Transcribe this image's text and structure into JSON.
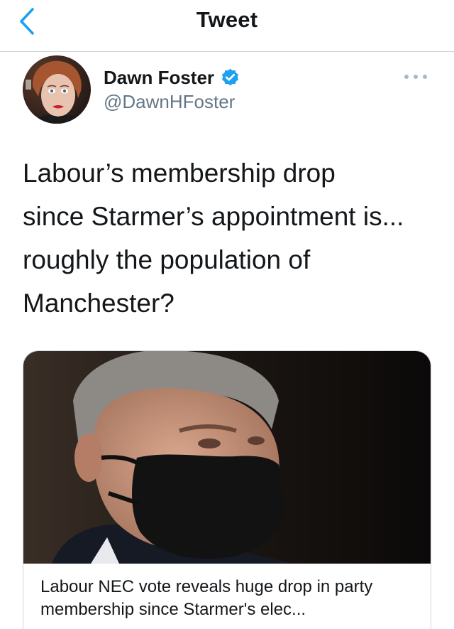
{
  "header": {
    "title": "Tweet",
    "back_icon": "chevron-left-icon"
  },
  "author": {
    "name": "Dawn Foster",
    "handle": "@DawnHFoster",
    "verified": true,
    "avatar_icon": "avatar"
  },
  "tweet": {
    "text": "Labour’s membership drop\nsince Starmer’s appointment is...\nroughly the population of\nManchester?"
  },
  "card": {
    "title": "Labour NEC vote reveals huge drop in party membership since Starmer's elec..."
  },
  "colors": {
    "accent": "#1da1f2",
    "text": "#14171a",
    "secondary": "#657786",
    "border": "#cfd6dc"
  }
}
